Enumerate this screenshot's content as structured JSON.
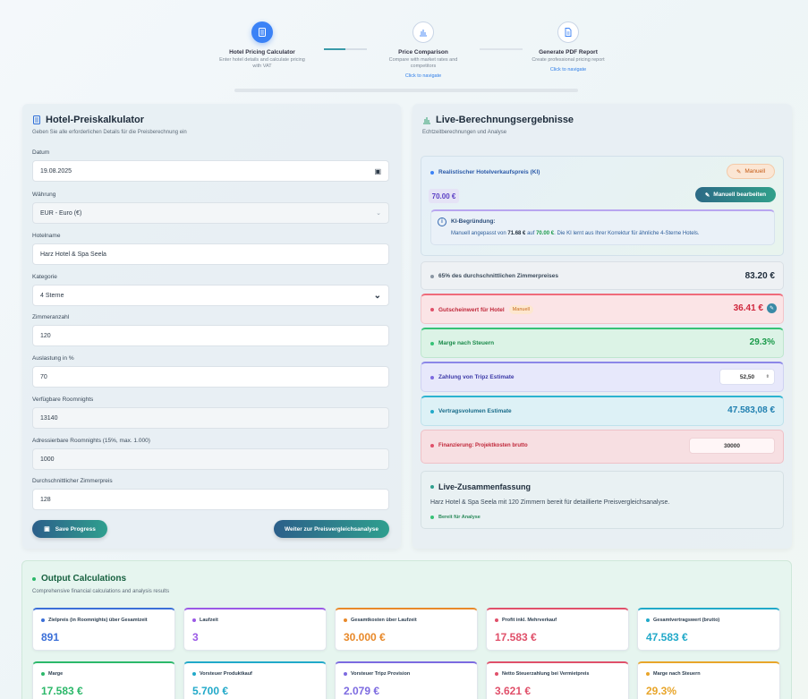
{
  "stepper": {
    "steps": [
      {
        "title": "Hotel Pricing Calculator",
        "desc": "Enter hotel details and calculate pricing with VAT",
        "link": ""
      },
      {
        "title": "Price Comparison",
        "desc": "Compare with market rates and competitors",
        "link": "Click to navigate"
      },
      {
        "title": "Generate PDF Report",
        "desc": "Create professional pricing report",
        "link": "Click to navigate"
      }
    ]
  },
  "form": {
    "title": "Hotel-Preiskalkulator",
    "subtitle": "Geben Sie alle erforderlichen Details für die Preisberechnung ein",
    "fields": [
      {
        "label": "Datum",
        "value": "19.08.2025"
      },
      {
        "label": "Währung",
        "value": "EUR - Euro (€)"
      },
      {
        "label": "Hotelname",
        "value": "Harz Hotel & Spa Seela"
      },
      {
        "label": "Kategorie",
        "value": "4 Sterne"
      },
      {
        "label": "Zimmeranzahl",
        "value": "120"
      },
      {
        "label": "Auslastung in %",
        "value": "70"
      },
      {
        "label": "Verfügbare Roomnights",
        "value": "13140"
      },
      {
        "label": "Adressierbare Roomnights (15%, max. 1.000)",
        "value": "1000"
      },
      {
        "label": "Durchschnittlicher Zimmerpreis",
        "value": "128"
      }
    ],
    "save_label": "Save Progress",
    "next_label": "Weiter zur Preisvergleichsanalyse"
  },
  "results": {
    "title": "Live-Berechnungsergebnisse",
    "subtitle": "Echtzeitberechnungen und Analyse",
    "ki": {
      "label": "Realistischer Hotelverkaufspreis (KI)",
      "value": "70.00 €",
      "manual_label": "Manuell",
      "edit_label": "Manuell bearbeiten",
      "reason_title": "KI-Begründung:",
      "reason_a": "Manuell angepasst von ",
      "reason_from": "71.68 €",
      "reason_b": " auf ",
      "reason_to": "70.00 €",
      "reason_c": ". Die KI lernt aus Ihrer Korrektur für ähnliche 4-Sterne Hotels."
    },
    "rows": [
      {
        "label": "65% des durchschnittlichen Zimmerpreises",
        "value": "83.20 €"
      },
      {
        "label": "Gutscheinwert für Hotel",
        "tag": "Manuell",
        "value": "36.41 €"
      },
      {
        "label": "Marge nach Steuern",
        "value": "29.3%"
      },
      {
        "label": "Zahlung von Tripz Estimate",
        "value": "52,50"
      },
      {
        "label": "Vertragsvolumen Estimate",
        "value": "47.583,08 €"
      },
      {
        "label": "Finanzierung: Projektkosten brutto",
        "value": "30000"
      }
    ],
    "summary": {
      "title": "Live-Zusammenfassung",
      "text": "Harz Hotel & Spa Seela mit 120 Zimmern bereit für detaillierte Preisvergleichsanalyse.",
      "status": "Bereit für Analyse"
    }
  },
  "output": {
    "title": "Output Calculations",
    "subtitle": "Comprehensive financial calculations and analysis results",
    "cards": [
      {
        "label": "Zielpreis (in Roomnights) über Gesamtzeit",
        "value": "891",
        "color": "#3b6fd8"
      },
      {
        "label": "Laufzeit",
        "value": "3",
        "color": "#9b59e6"
      },
      {
        "label": "Gesamtkosten über Laufzeit",
        "value": "30.000 €",
        "color": "#e8892a"
      },
      {
        "label": "Profit inkl. Mehrverkauf",
        "value": "17.583 €",
        "color": "#e0506a"
      },
      {
        "label": "Gesamtvertragswert (brutto)",
        "value": "47.583 €",
        "color": "#21a9c9"
      },
      {
        "label": "Marge",
        "value": "17.583 €",
        "color": "#2cb86a"
      },
      {
        "label": "Vorsteuer Produktkauf",
        "value": "5.700 €",
        "color": "#21a9c9"
      },
      {
        "label": "Vorsteuer Tripz Provision",
        "value": "2.079 €",
        "color": "#7c6ae0"
      },
      {
        "label": "Netto Steuerzahlung bei Vermietpreis",
        "value": "3.621 €",
        "color": "#e0506a"
      },
      {
        "label": "Marge nach Steuern",
        "value": "29.3%",
        "color": "#e8a52a"
      }
    ]
  },
  "colors": {
    "accent": "#3b82f6",
    "teal": "#2f9f8e",
    "danger": "#d0283e",
    "success": "#1a9a4a"
  }
}
